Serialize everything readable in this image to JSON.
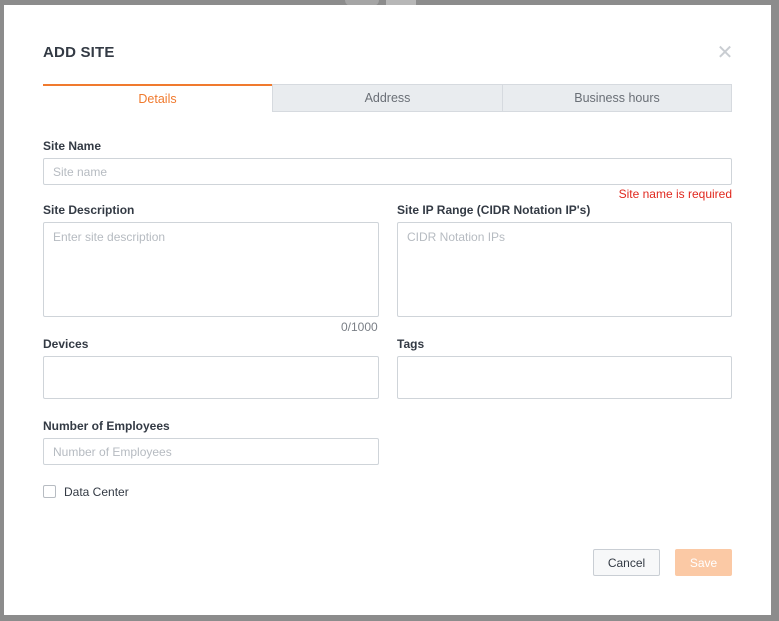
{
  "modal": {
    "title": "ADD SITE",
    "close_icon": "close-icon"
  },
  "tabs": [
    {
      "label": "Details",
      "active": true
    },
    {
      "label": "Address",
      "active": false
    },
    {
      "label": "Business hours",
      "active": false
    }
  ],
  "form": {
    "site_name": {
      "label": "Site Name",
      "placeholder": "Site name",
      "value": "",
      "error": "Site name is required"
    },
    "site_description": {
      "label": "Site Description",
      "placeholder": "Enter site description",
      "value": "",
      "counter": "0/1000"
    },
    "site_ip_range": {
      "label": "Site IP Range (CIDR Notation IP's)",
      "placeholder": "CIDR Notation IPs",
      "value": ""
    },
    "devices": {
      "label": "Devices",
      "value": ""
    },
    "tags": {
      "label": "Tags",
      "value": ""
    },
    "number_of_employees": {
      "label": "Number of Employees",
      "placeholder": "Number of Employees",
      "value": ""
    },
    "data_center": {
      "label": "Data Center",
      "checked": false
    }
  },
  "footer": {
    "cancel_label": "Cancel",
    "save_label": "Save"
  },
  "colors": {
    "accent": "#f07a2e",
    "error": "#e0281e",
    "save_disabled": "#fbc9a5"
  }
}
